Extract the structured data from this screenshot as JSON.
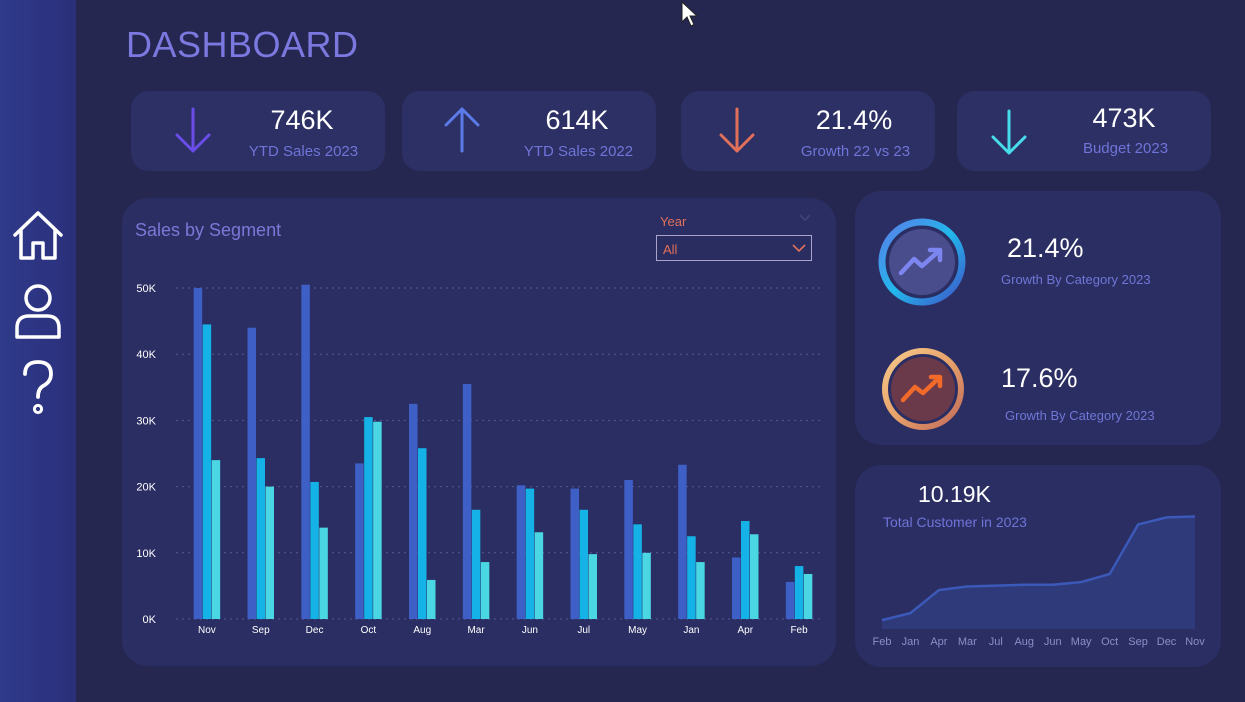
{
  "dashboard_title": "DASHBOARD",
  "nav": [
    "home-icon",
    "user-icon",
    "help-icon"
  ],
  "kpis": [
    {
      "value": "746K",
      "label": "YTD Sales 2023",
      "arrow": "down",
      "color": "#6a4de8"
    },
    {
      "value": "614K",
      "label": "YTD Sales 2022",
      "arrow": "up",
      "color": "#5b7ce8"
    },
    {
      "value": "21.4%",
      "label": "Growth 22 vs 23",
      "arrow": "down",
      "color": "#e0705a"
    },
    {
      "value": "473K",
      "label": "Budget 2023",
      "arrow": "down",
      "color": "#46dcea"
    }
  ],
  "sales_chart": {
    "title": "Sales by Segment",
    "filter_label": "Year",
    "filter_value": "All"
  },
  "chart_data": {
    "type": "bar",
    "title": "Sales by Segment",
    "categories": [
      "Nov",
      "Sep",
      "Dec",
      "Oct",
      "Aug",
      "Mar",
      "Jun",
      "Jul",
      "May",
      "Jan",
      "Apr",
      "Feb"
    ],
    "series": [
      {
        "values": [
          50000,
          44000,
          50500,
          23500,
          32500,
          35500,
          20200,
          19700,
          21000,
          23300,
          9300,
          5600
        ],
        "color": "#3d5fc6"
      },
      {
        "values": [
          44500,
          24300,
          20700,
          30500,
          25800,
          16500,
          19700,
          16500,
          14300,
          12500,
          14800,
          8000
        ],
        "color": "#14b2e6"
      },
      {
        "values": [
          24000,
          20000,
          13800,
          29800,
          5900,
          8600,
          13100,
          9800,
          10000,
          8600,
          12800,
          6800
        ],
        "color": "#4ad6e2"
      }
    ],
    "y_ticks": [
      "0K",
      "10K",
      "20K",
      "30K",
      "40K",
      "50K"
    ],
    "ylim": [
      0,
      50000
    ],
    "grid": true
  },
  "growth_items": [
    {
      "value": "21.4%",
      "label": "Growth By Category 2023",
      "ring": "blue"
    },
    {
      "value": "17.6%",
      "label": "Growth By Category 2023",
      "ring": "orange"
    }
  ],
  "customers": {
    "value": "10.19K",
    "label": "Total Customer in 2023",
    "area": {
      "type": "area",
      "categories": [
        "Feb",
        "Jan",
        "Apr",
        "Mar",
        "Jul",
        "Aug",
        "Jun",
        "May",
        "Oct",
        "Sep",
        "Dec",
        "Nov"
      ],
      "values": [
        0.5,
        0.9,
        2.2,
        2.4,
        2.45,
        2.5,
        2.5,
        2.65,
        3.1,
        5.9,
        6.3,
        6.35
      ],
      "color": "#3b59b8"
    }
  }
}
